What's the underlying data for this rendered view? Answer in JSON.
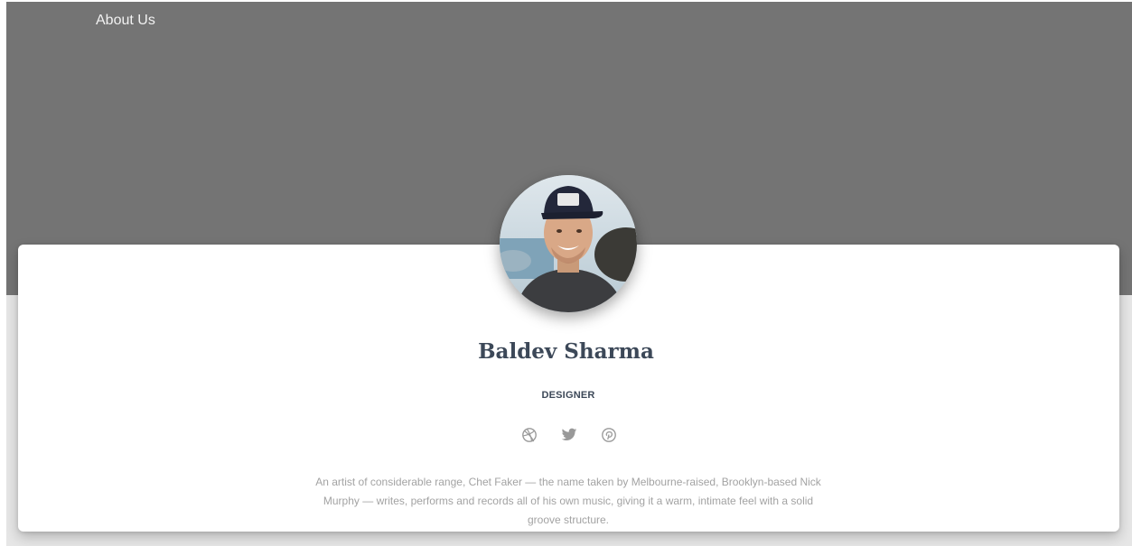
{
  "nav": {
    "about_label": "About Us"
  },
  "profile": {
    "name": "Baldev Sharma",
    "role": "DESIGNER",
    "bio": "An artist of considerable range, Chet Faker — the name taken by Melbourne-raised, Brooklyn-based Nick Murphy — writes, performs and records all of his own music, giving it a warm, intimate feel with a solid groove structure.",
    "social_icons": [
      "dribbble-icon",
      "twitter-icon",
      "pinterest-icon"
    ]
  },
  "colors": {
    "header_bg": "#747474",
    "heading": "#3c4858",
    "muted_text": "#a3a3a3",
    "icon": "#999999"
  }
}
